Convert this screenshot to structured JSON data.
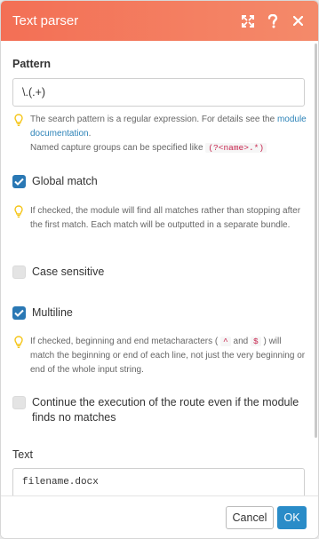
{
  "header": {
    "title": "Text parser",
    "icons": [
      "expand-icon",
      "help-icon",
      "close-icon"
    ]
  },
  "pattern": {
    "label": "Pattern",
    "value": "\\.(.+)",
    "hint_line1": "The search pattern is a regular expression. For details see the",
    "hint_link": "module documentation",
    "hint_after_link": ".",
    "hint_line2": "Named capture groups can be specified like",
    "hint_code": "(?<name>.*)"
  },
  "global_match": {
    "label": "Global match",
    "checked": true,
    "hint": "If checked, the module will find all matches rather than stopping after the first match. Each match will be outputted in a separate bundle."
  },
  "case_sensitive": {
    "label": "Case sensitive",
    "checked": false
  },
  "multiline": {
    "label": "Multiline",
    "checked": true,
    "hint_part1": "If checked, beginning and end metacharacters (",
    "hint_code1": "^",
    "hint_and": "and",
    "hint_code2": "$",
    "hint_part2": ") will match the beginning or end of each line, not just the very beginning or end of the whole input string."
  },
  "continue_route": {
    "label": "Continue the execution of the route even if the module finds no matches",
    "checked": false
  },
  "text": {
    "label": "Text",
    "value": "filename.docx"
  },
  "footer": {
    "cancel_label": "Cancel",
    "ok_label": "OK"
  },
  "colors": {
    "header_start": "#f36f55",
    "header_end": "#f48a6a",
    "checkbox_on": "#2a78b4",
    "ok_button": "#2a8cc8",
    "link": "#2d83b8",
    "hint_bulb": "#f5c518"
  }
}
